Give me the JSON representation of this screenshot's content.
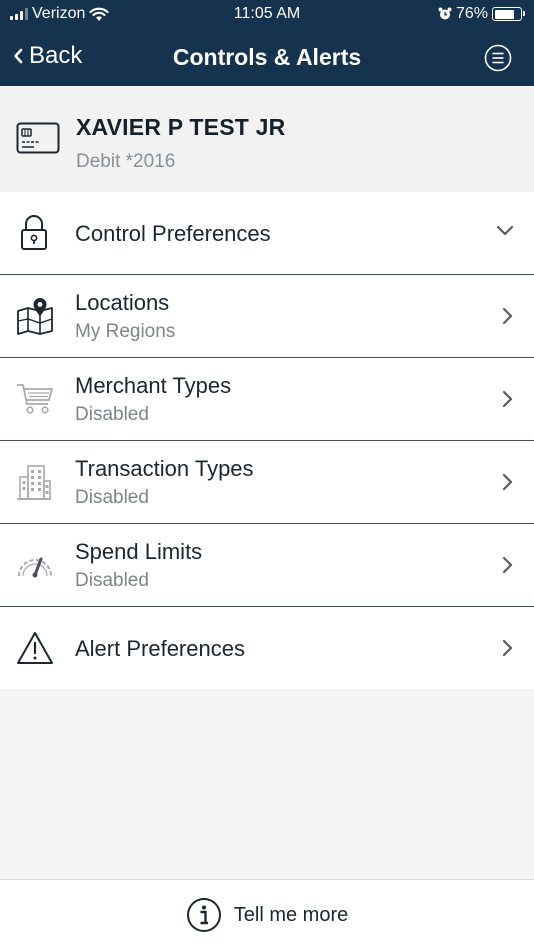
{
  "status_bar": {
    "carrier": "Verizon",
    "time": "11:05 AM",
    "battery": "76%",
    "battery_level": 0.76
  },
  "nav": {
    "back_label": "Back",
    "title": "Controls & Alerts",
    "menu_icon": "menu-lines-icon"
  },
  "card": {
    "name": "XAVIER P TEST JR",
    "subtitle": "Debit *2016",
    "icon": "credit-card-icon"
  },
  "items": [
    {
      "title": "Control Preferences",
      "subtitle": "",
      "icon": "lock-icon",
      "chevron": "down"
    },
    {
      "title": "Locations",
      "subtitle": "My Regions",
      "icon": "map-pin-icon",
      "chevron": "right"
    },
    {
      "title": "Merchant Types",
      "subtitle": "Disabled",
      "icon": "cart-icon",
      "chevron": "right"
    },
    {
      "title": "Transaction Types",
      "subtitle": "Disabled",
      "icon": "buildings-icon",
      "chevron": "right"
    },
    {
      "title": "Spend Limits",
      "subtitle": "Disabled",
      "icon": "speedometer-icon",
      "chevron": "right"
    },
    {
      "title": "Alert Preferences",
      "subtitle": "",
      "icon": "warning-icon",
      "chevron": "right"
    }
  ],
  "footer": {
    "label": "Tell me more",
    "icon": "info-icon"
  },
  "colors": {
    "header_bg": "#15324f",
    "text_dark": "#1c2630",
    "text_muted": "#7f8489",
    "disabled_icon": "#a6a9ad",
    "divider": "#4a4f55"
  }
}
